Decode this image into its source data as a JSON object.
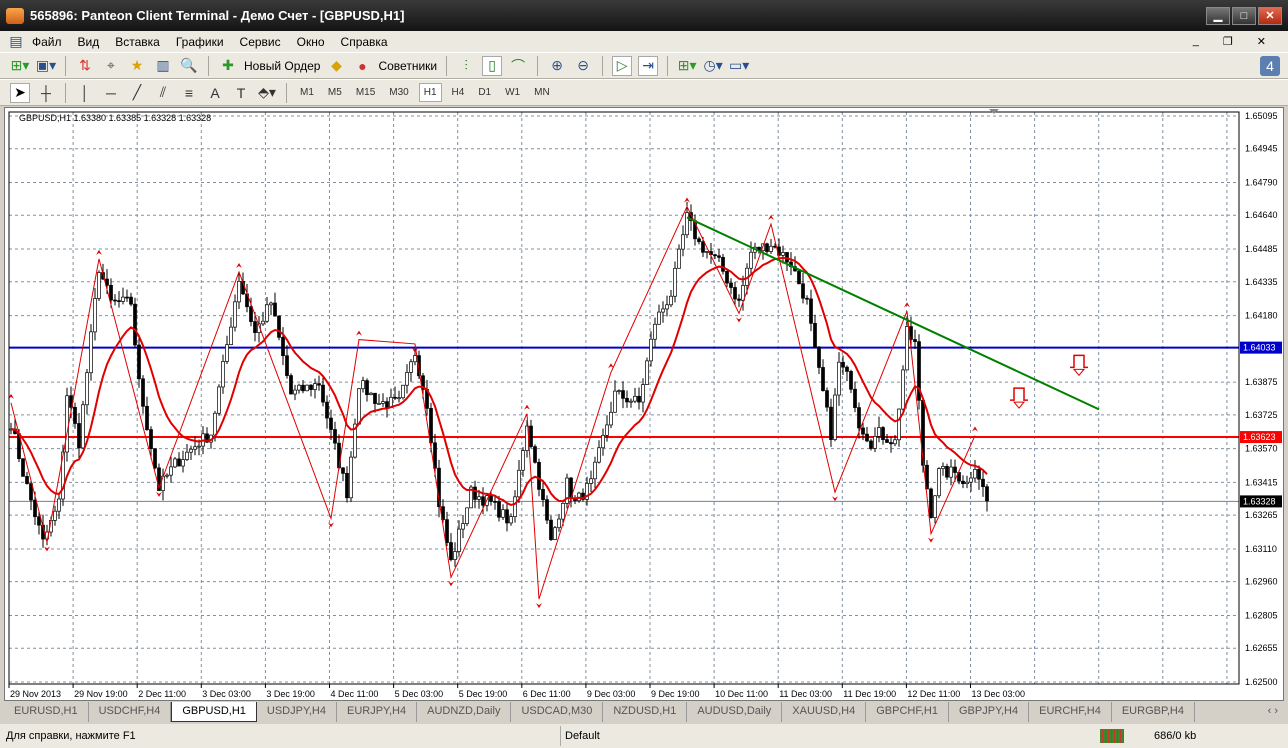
{
  "window": {
    "title": "565896: Panteon Client Terminal - Демо Счет - [GBPUSD,H1]"
  },
  "menu": [
    "Файл",
    "Вид",
    "Вставка",
    "Графики",
    "Сервис",
    "Окно",
    "Справка"
  ],
  "toolbar": {
    "new_order": "Новый Ордер",
    "experts": "Советники"
  },
  "timeframes": [
    "M1",
    "M5",
    "M15",
    "M30",
    "H1",
    "H4",
    "D1",
    "W1",
    "MN"
  ],
  "active_timeframe": "H1",
  "chart_header": "GBPUSD,H1  1.63380 1.63385 1.63328 1.63328",
  "chart_data": {
    "type": "candlestick",
    "symbol": "GBPUSD",
    "timeframe": "H1",
    "ylim": [
      1.625,
      1.65095
    ],
    "price_ticks": [
      "1.65095",
      "1.64945",
      "1.64790",
      "1.64640",
      "1.64485",
      "1.64335",
      "1.64180",
      "1.63875",
      "1.63725",
      "1.63570",
      "1.63415",
      "1.63265",
      "1.63110",
      "1.62960",
      "1.62805",
      "1.62655",
      "1.62500"
    ],
    "time_ticks": [
      "29 Nov 2013",
      "29 Nov 19:00",
      "2 Dec 11:00",
      "3 Dec 03:00",
      "3 Dec 19:00",
      "4 Dec 11:00",
      "5 Dec 03:00",
      "5 Dec 19:00",
      "6 Dec 11:00",
      "9 Dec 03:00",
      "9 Dec 19:00",
      "10 Dec 11:00",
      "11 Dec 03:00",
      "11 Dec 19:00",
      "12 Dec 11:00",
      "13 Dec 03:00"
    ],
    "close_path": [
      [
        0,
        1.6369
      ],
      [
        3,
        1.6346
      ],
      [
        8,
        1.6314
      ],
      [
        12,
        1.6332
      ],
      [
        14,
        1.6382
      ],
      [
        17,
        1.636
      ],
      [
        22,
        1.644
      ],
      [
        25,
        1.6424
      ],
      [
        30,
        1.6424
      ],
      [
        32,
        1.6387
      ],
      [
        37,
        1.6339
      ],
      [
        41,
        1.635
      ],
      [
        47,
        1.636
      ],
      [
        50,
        1.6364
      ],
      [
        57,
        1.6435
      ],
      [
        61,
        1.641
      ],
      [
        65,
        1.6424
      ],
      [
        70,
        1.6382
      ],
      [
        77,
        1.6387
      ],
      [
        80,
        1.6364
      ],
      [
        84,
        1.6337
      ],
      [
        87,
        1.6387
      ],
      [
        92,
        1.6378
      ],
      [
        97,
        1.6378
      ],
      [
        101,
        1.6401
      ],
      [
        104,
        1.6378
      ],
      [
        107,
        1.6332
      ],
      [
        110,
        1.6305
      ],
      [
        115,
        1.6337
      ],
      [
        120,
        1.6332
      ],
      [
        125,
        1.6323
      ],
      [
        129,
        1.6369
      ],
      [
        132,
        1.6341
      ],
      [
        135,
        1.6314
      ],
      [
        139,
        1.6341
      ],
      [
        141,
        1.6332
      ],
      [
        145,
        1.6341
      ],
      [
        151,
        1.6382
      ],
      [
        157,
        1.6378
      ],
      [
        161,
        1.6415
      ],
      [
        165,
        1.6428
      ],
      [
        169,
        1.6463
      ],
      [
        172,
        1.6451
      ],
      [
        177,
        1.6442
      ],
      [
        182,
        1.6424
      ],
      [
        185,
        1.6447
      ],
      [
        190,
        1.6451
      ],
      [
        195,
        1.6442
      ],
      [
        199,
        1.6424
      ],
      [
        201,
        1.6401
      ],
      [
        205,
        1.6364
      ],
      [
        207,
        1.6396
      ],
      [
        210,
        1.6387
      ],
      [
        212,
        1.6369
      ],
      [
        215,
        1.636
      ],
      [
        217,
        1.6364
      ],
      [
        221,
        1.636
      ],
      [
        224,
        1.641
      ],
      [
        226,
        1.6405
      ],
      [
        228,
        1.635
      ],
      [
        230,
        1.6328
      ],
      [
        232,
        1.6346
      ],
      [
        236,
        1.6346
      ],
      [
        239,
        1.6341
      ],
      [
        241,
        1.635
      ],
      [
        244,
        1.6333
      ]
    ],
    "zigzag": [
      [
        0,
        1.6378
      ],
      [
        9,
        1.6314
      ],
      [
        22,
        1.6444
      ],
      [
        37,
        1.6339
      ],
      [
        57,
        1.6438
      ],
      [
        80,
        1.6325
      ],
      [
        87,
        1.6407
      ],
      [
        101,
        1.6405
      ],
      [
        110,
        1.6298
      ],
      [
        129,
        1.6373
      ],
      [
        132,
        1.6288
      ],
      [
        150,
        1.6392
      ],
      [
        169,
        1.6468
      ],
      [
        182,
        1.6419
      ],
      [
        190,
        1.646
      ],
      [
        206,
        1.6337
      ],
      [
        224,
        1.642
      ],
      [
        230,
        1.6318
      ],
      [
        241,
        1.6363
      ]
    ],
    "trendline": [
      [
        169,
        1.6463
      ],
      [
        272,
        1.6375
      ]
    ],
    "hlines": [
      {
        "price": "1.64033",
        "color": "#0000cc"
      },
      {
        "price": "1.63623",
        "color": "#ff0000"
      }
    ],
    "current_price": "1.63328",
    "signals": [
      [
        252,
        1.6382
      ],
      [
        267,
        1.6397
      ]
    ]
  },
  "tabs": [
    "EURUSD,H1",
    "USDCHF,H4",
    "GBPUSD,H1",
    "USDJPY,H4",
    "EURJPY,H4",
    "AUDNZD,Daily",
    "USDCAD,M30",
    "NZDUSD,H1",
    "AUDUSD,Daily",
    "XAUUSD,H4",
    "GBPCHF,H1",
    "GBPJPY,H4",
    "EURCHF,H4",
    "EURGBP,H4"
  ],
  "active_tab": "GBPUSD,H1",
  "status": {
    "help": "Для справки, нажмите F1",
    "profile": "Default",
    "traffic": "686/0 kb"
  }
}
